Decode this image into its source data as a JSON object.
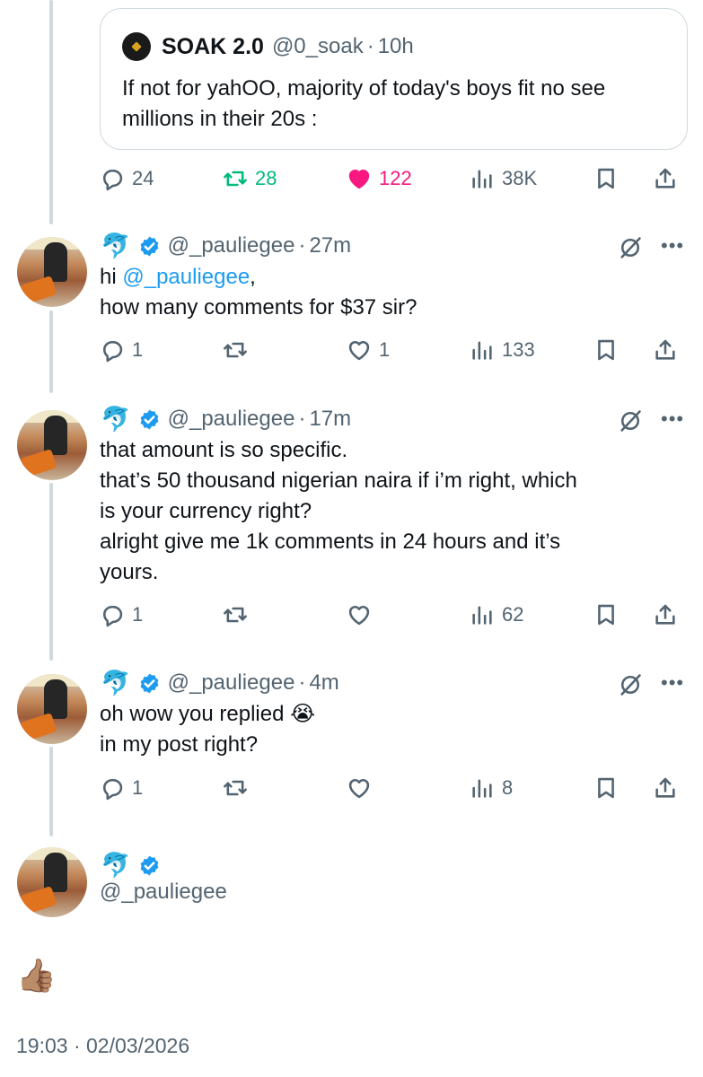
{
  "quote": {
    "name": "SOAK 2.0",
    "handle": "@0_soak",
    "separator": "·",
    "time": "10h",
    "text": "If not for yahOO, majority of today's boys fit no see millions in their 20s :",
    "counts": {
      "replies": "24",
      "reposts": "28",
      "likes": "122",
      "views": "38K"
    },
    "colors": {
      "repost_active": "#00ba7c",
      "like_active": "#f91880"
    }
  },
  "replies": [
    {
      "emoji": "🐬",
      "handle": "@_pauliegee",
      "separator": "·",
      "time": "27m",
      "lines": [
        {
          "prefix": "hi ",
          "mention": "@_pauliegee",
          "suffix": ","
        },
        {
          "text": "how many comments for $37 sir?"
        }
      ],
      "counts": {
        "replies": "1",
        "reposts": "",
        "likes": "1",
        "views": "133"
      }
    },
    {
      "emoji": "🐬",
      "handle": "@_pauliegee",
      "separator": "·",
      "time": "17m",
      "lines": [
        {
          "text": "that amount is so specific."
        },
        {
          "text": "that’s 50 thousand nigerian naira if i’m right, which"
        },
        {
          "text": "is your currency right?"
        },
        {
          "text": "alright give me 1k comments in 24 hours and it’s"
        },
        {
          "text": "yours."
        }
      ],
      "counts": {
        "replies": "1",
        "reposts": "",
        "likes": "",
        "views": "62"
      }
    },
    {
      "emoji": "🐬",
      "handle": "@_pauliegee",
      "separator": "·",
      "time": "4m",
      "lines": [
        {
          "text": "oh wow you replied 😭"
        },
        {
          "text": "in my post right?"
        }
      ],
      "counts": {
        "replies": "1",
        "reposts": "",
        "likes": "",
        "views": "8"
      }
    }
  ],
  "focused": {
    "emoji": "🐬",
    "handle": "@_pauliegee",
    "body": "👍🏽",
    "timestamp": "19:03 · 02/03/2026"
  },
  "icons": {
    "reply": "reply-icon",
    "repost": "repost-icon",
    "like": "heart-icon",
    "views": "views-icon",
    "bookmark": "bookmark-icon",
    "share": "share-icon",
    "verified": "verified-badge-icon",
    "grok": "grok-icon",
    "more": "more-icon"
  },
  "colors": {
    "text": "#0f1419",
    "secondary": "#536471",
    "mention": "#1d9bf0",
    "verified": "#1d9bf0",
    "border": "#cfd9de"
  }
}
